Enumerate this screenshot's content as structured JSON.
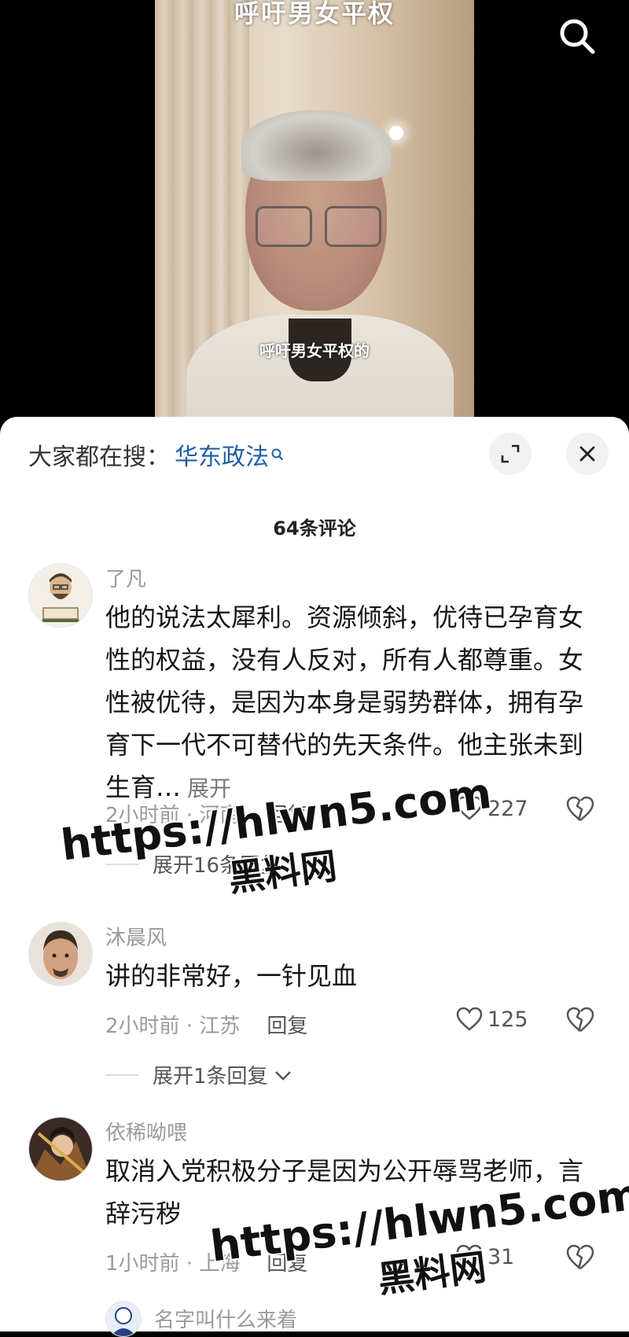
{
  "video": {
    "title_overlay": "呼吁男女平权",
    "subtitle": "呼吁男女平权的"
  },
  "sheet": {
    "trending_label": "大家都在搜：",
    "trending_term": "华东政法",
    "comment_count": "64条评论"
  },
  "comments": [
    {
      "user": "了凡",
      "text": "他的说法太犀利。资源倾斜，优待已孕育女性的权益，没有人反对，所有人都尊重。女性被优待，是因为本身是弱势群体，拥有孕育下一代不可替代的先天条件。他主张未到生育…",
      "more": "展开",
      "meta": "2小时前 · 河南",
      "reply": "回复",
      "likes": "227",
      "expand_replies": "展开16条回复"
    },
    {
      "user": "沐晨风",
      "text": "讲的非常好，一针见血",
      "meta": "2小时前 · 江苏",
      "reply": "回复",
      "likes": "125",
      "expand_replies": "展开1条回复"
    },
    {
      "user": "依稀呦喂",
      "text": "取消入党积极分子是因为公开辱骂老师，言辞污秽",
      "meta": "1小时前 · 上海",
      "reply": "回复",
      "likes": "31"
    },
    {
      "user": "名字叫什么来着"
    }
  ],
  "watermarks": [
    {
      "url": "https://hlwn5.com",
      "cn": "黑料网"
    },
    {
      "url": "https://hlwn5.com",
      "cn": "黑料网"
    }
  ],
  "colors": {
    "link_blue": "#1f5fa8",
    "meta_gray": "#9a9a9a"
  },
  "icons": [
    "search-icon",
    "expand-icon",
    "close-icon",
    "heart-icon",
    "broken-heart-icon",
    "chevron-down-icon"
  ]
}
